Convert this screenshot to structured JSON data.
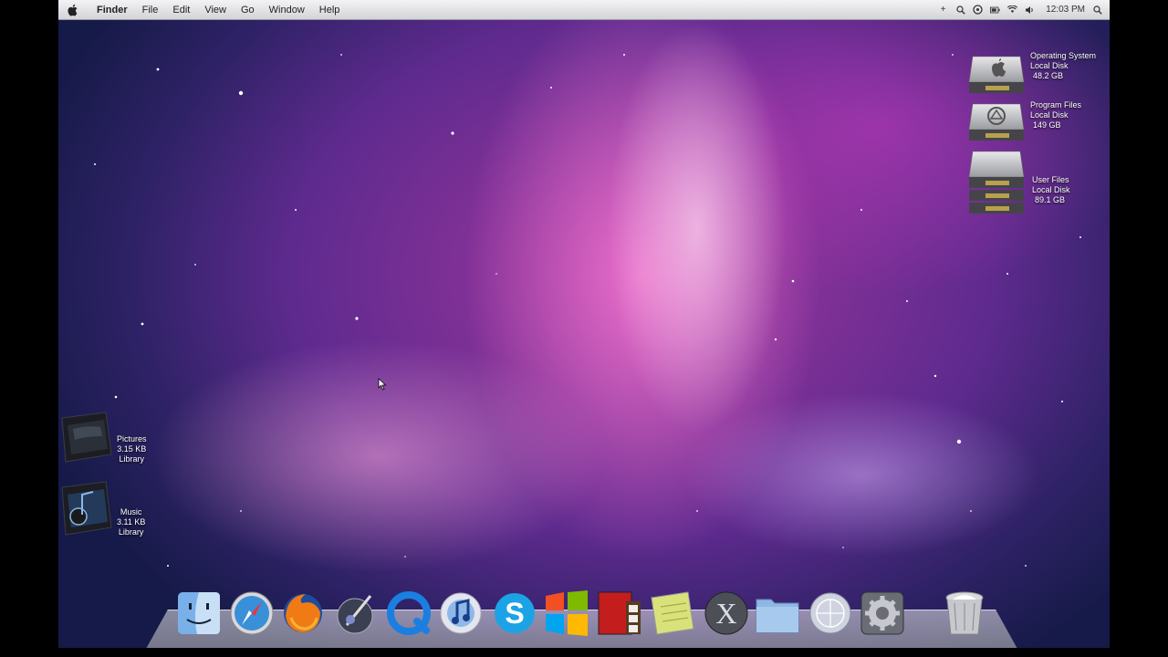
{
  "menubar": {
    "app_name": "Finder",
    "menus": [
      "File",
      "Edit",
      "View",
      "Go",
      "Window",
      "Help"
    ],
    "clock": "12:03 PM",
    "extras_icons": [
      "plus-icon",
      "search-small-icon",
      "sync-icon",
      "battery-icon",
      "wifi-icon",
      "volume-icon"
    ]
  },
  "drives": [
    {
      "name": "Operating System",
      "type": "Local Disk",
      "size": "48.2 GB"
    },
    {
      "name": "Program Files",
      "type": "Local Disk",
      "size": "149 GB"
    },
    {
      "name": "User Files",
      "type": "Local Disk",
      "size": "89.1 GB"
    }
  ],
  "folders": [
    {
      "name": "Pictures",
      "size": "3.15 KB",
      "kind": "Library"
    },
    {
      "name": "Music",
      "size": "3.11 KB",
      "kind": "Library"
    }
  ],
  "dock": {
    "items": [
      "finder-icon",
      "safari-icon",
      "firefox-icon",
      "photo-editor-icon",
      "quicktime-icon",
      "itunes-icon",
      "skype-icon",
      "windows-icon",
      "photo-booth-icon",
      "notes-icon",
      "mac-os-x-icon",
      "documents-folder-icon",
      "network-icon",
      "system-preferences-icon",
      "trash-icon"
    ]
  },
  "colors": {
    "wallpaper_pink": "#c33fb0",
    "wallpaper_purple": "#5e2a8e",
    "wallpaper_navy": "#161a48",
    "menubar": "#e6e6ea"
  }
}
